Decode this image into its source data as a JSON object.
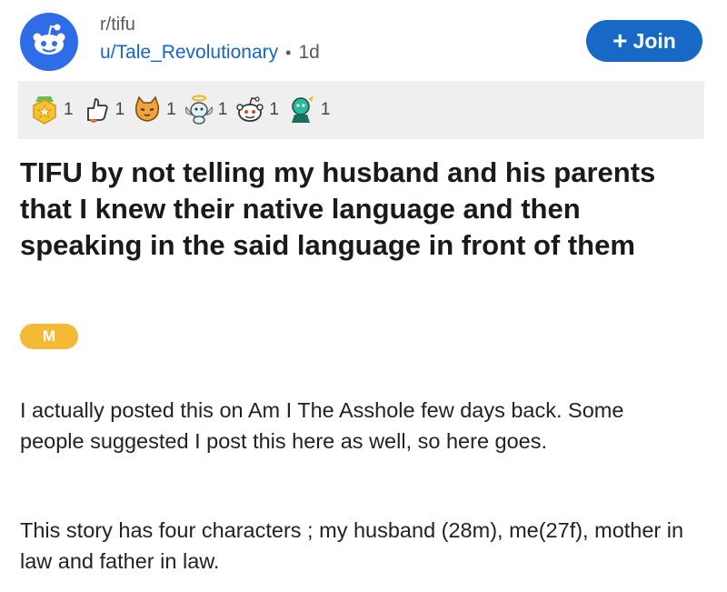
{
  "post": {
    "subreddit": "r/tifu",
    "author": "u/Tale_Revolutionary",
    "separator": "•",
    "age": "1d",
    "join_label": "Join",
    "join_icon": "plus-icon",
    "flair": "M",
    "title": "TIFU by not telling my husband and his parents that I knew their native language and then speaking in the said language in front of them",
    "paragraphs": [
      "I actually posted this on Am I The Asshole few days back. Some people suggested I post this here as well, so here goes.",
      "This story has four characters ; my husband (28m), me(27f), mother in law and father in law."
    ]
  },
  "awards": [
    {
      "icon": "gold-medal-icon",
      "count": "1"
    },
    {
      "icon": "thumbs-up-rocket-icon",
      "count": "1"
    },
    {
      "icon": "cat-face-icon",
      "count": "1"
    },
    {
      "icon": "angel-snoo-icon",
      "count": "1"
    },
    {
      "icon": "snoo-face-icon",
      "count": "1"
    },
    {
      "icon": "teal-snoo-icon",
      "count": "1"
    }
  ],
  "colors": {
    "accent": "#1868c5",
    "flair": "#f4b935",
    "subreddit_icon": "#2f6ce8",
    "awards_bar": "#efefef"
  }
}
